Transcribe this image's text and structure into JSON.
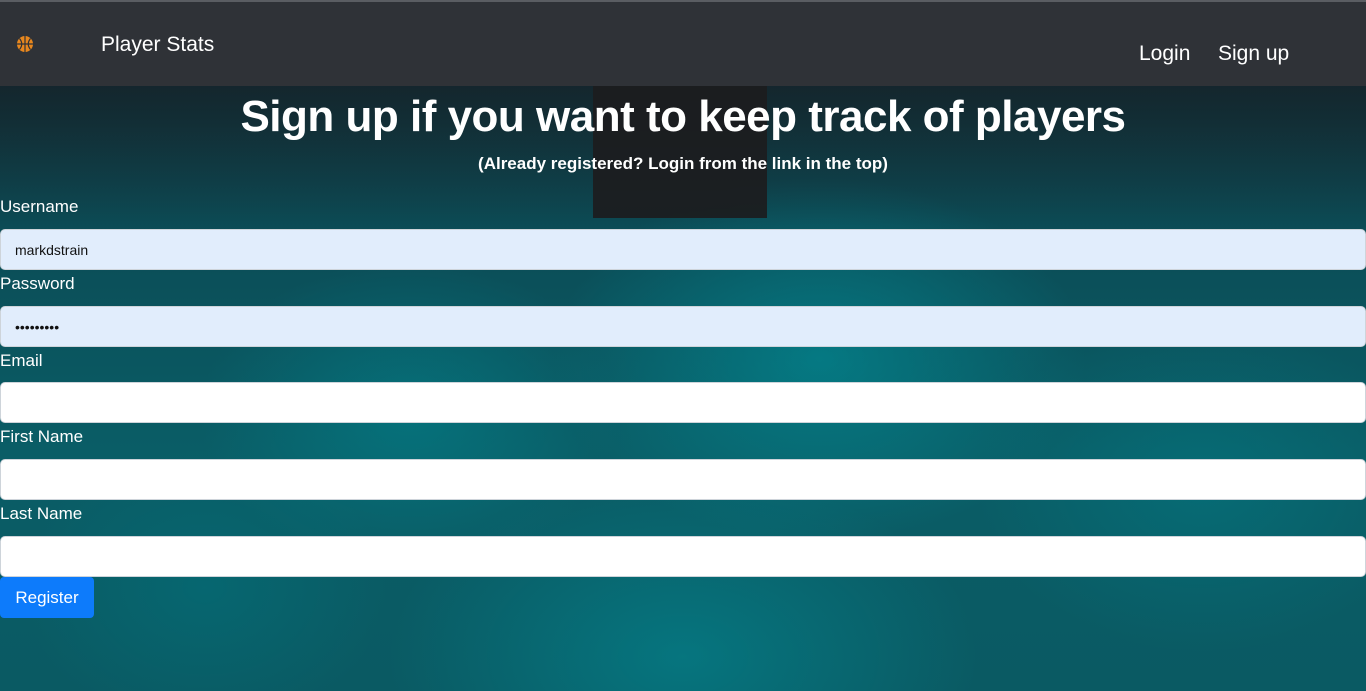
{
  "navbar": {
    "brand_icon": "basketball-icon",
    "brand_name": "Player Stats",
    "links": {
      "login": "Login",
      "signup": "Sign up"
    }
  },
  "page": {
    "title": "Sign up if you want to keep track of players",
    "subtitle": "(Already registered? Login from the link in the top)"
  },
  "form": {
    "username": {
      "label": "Username",
      "value": "markdstrain"
    },
    "password": {
      "label": "Password",
      "value": "markdstra"
    },
    "email": {
      "label": "Email",
      "value": ""
    },
    "first_name": {
      "label": "First Name",
      "value": ""
    },
    "last_name": {
      "label": "Last Name",
      "value": ""
    },
    "submit_label": "Register"
  },
  "colors": {
    "navbar_bg": "#2f3237",
    "primary_button": "#0d7bfb",
    "autofill_bg": "#e1edfc",
    "brand_icon": "#e8871e"
  }
}
